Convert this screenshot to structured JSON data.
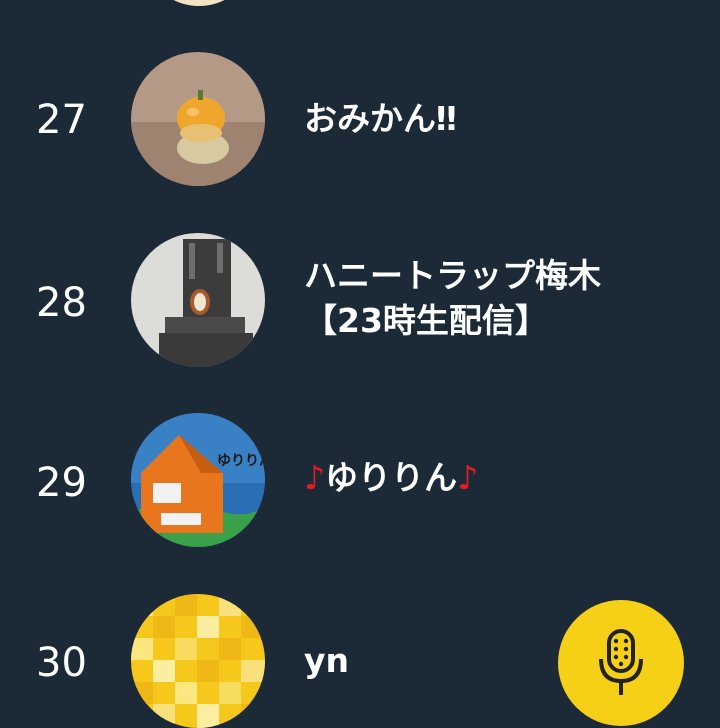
{
  "ranking": {
    "items": [
      {
        "rank": "27",
        "name": "おみかん‼"
      },
      {
        "rank": "28",
        "name_line1": "ハニートラップ梅木",
        "name_line2": "【23時生配信】"
      },
      {
        "rank": "29",
        "note_left": "♪",
        "name": "ゆりりん",
        "note_right": "♪"
      },
      {
        "rank": "30",
        "name": "yn"
      }
    ]
  },
  "fab": {
    "icon": "microphone-icon"
  },
  "colors": {
    "background": "#1c2a38",
    "text": "#ffffff",
    "note": "#e81c26",
    "fab": "#f6cf17",
    "mic": "#222222"
  }
}
